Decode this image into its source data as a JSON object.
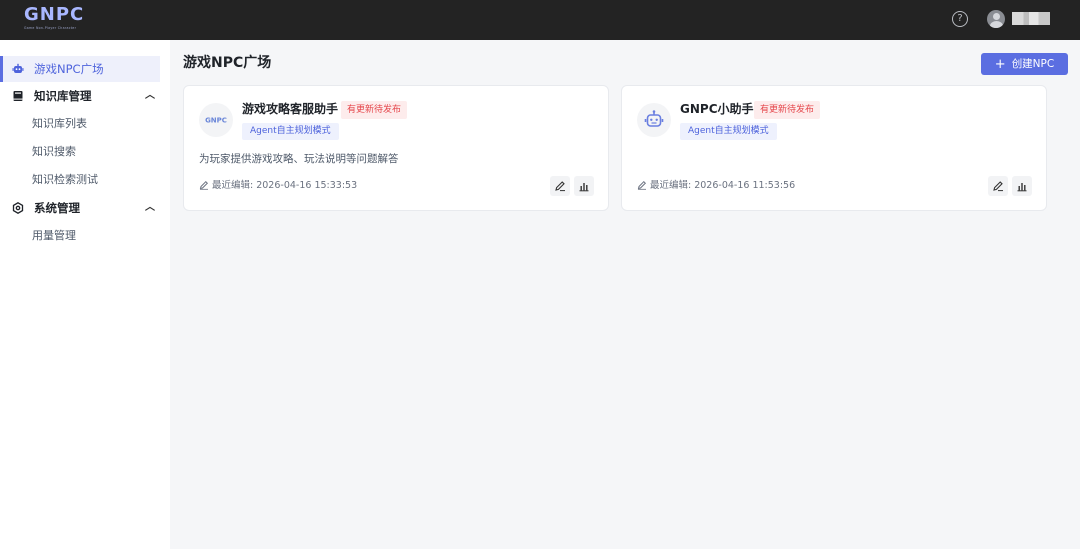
{
  "brand": {
    "logo_text": "GNPC",
    "logo_subtext": "Game Non-Player Character"
  },
  "header": {
    "help_icon": "question-circle-icon",
    "avatar_icon": "user-avatar-icon"
  },
  "sidebar": {
    "items": [
      {
        "label": "游戏NPC广场",
        "icon": "robot-icon",
        "active": true
      },
      {
        "label": "知识库管理",
        "icon": "book-icon",
        "expanded": true,
        "children": [
          "知识库列表",
          "知识搜索",
          "知识检索测试"
        ]
      },
      {
        "label": "系统管理",
        "icon": "settings-icon",
        "expanded": true,
        "children": [
          "用量管理"
        ]
      }
    ]
  },
  "main": {
    "title": "游戏NPC广场",
    "create_button": {
      "icon": "plus-icon",
      "label": "创建NPC"
    },
    "cards": [
      {
        "name": "游戏攻略客服助手",
        "status_tag": "有更新待发布",
        "mode_tag": "Agent自主规划模式",
        "description": "为玩家提供游戏攻略、玩法说明等问题解答",
        "edited_label": "最近编辑: 2026-04-16 15:33:53",
        "avatar": "GNPC"
      },
      {
        "name": "GNPC小助手",
        "status_tag": "有更新待发布",
        "mode_tag": "Agent自主规划模式",
        "description": "",
        "edited_label": "最近编辑: 2026-04-16 11:53:56",
        "avatar": "robot"
      }
    ]
  },
  "colors": {
    "primary": "#5b6ee1",
    "topbar": "#232323",
    "tag_red_bg": "#fdecec",
    "tag_red_text": "#e5484d",
    "tag_blue_bg": "#eef1fd",
    "tag_blue_text": "#4e63dc"
  }
}
